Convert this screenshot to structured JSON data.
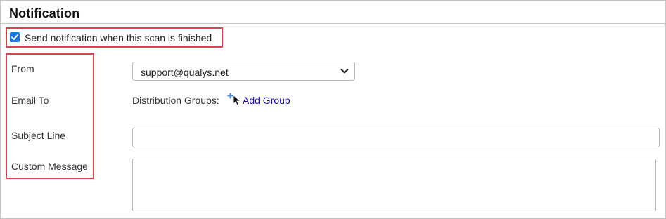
{
  "section": {
    "title": "Notification"
  },
  "notify": {
    "checkbox_label": "Send notification when this scan is finished",
    "checked": true
  },
  "form": {
    "from_label": "From",
    "from_value": "support@qualys.net",
    "email_to_label": "Email To",
    "distribution_groups_label": "Distribution Groups:",
    "add_group_label": "Add Group",
    "subject_label": "Subject Line",
    "subject_value": "",
    "custom_message_label": "Custom Message",
    "custom_message_value": ""
  },
  "icons": {
    "checkbox": "checkmark-icon",
    "select": "chevron-down-icon",
    "add_group": "plus-icon",
    "pointer": "cursor-icon"
  },
  "colors": {
    "accent": "#1a73e8",
    "highlight_box": "#d9444b",
    "link": "#1a0dab",
    "border": "#c6c6c6"
  }
}
